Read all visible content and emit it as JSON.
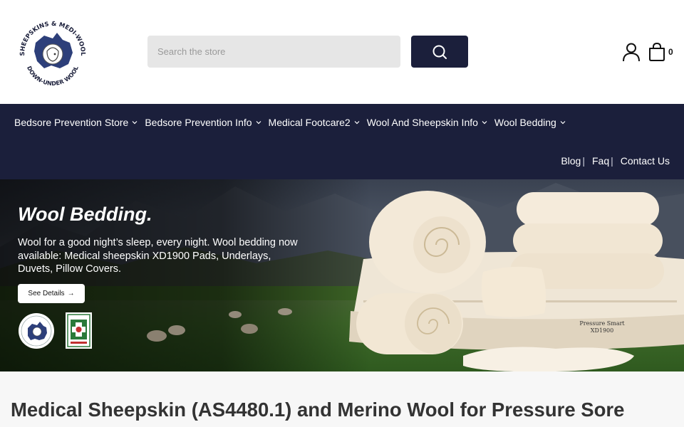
{
  "header": {
    "logo_text_top": "SHEEPSKINS & MEDI-WOOL",
    "logo_text_bottom": "DOWN-UNDER WOOL",
    "search_placeholder": "Search the store",
    "cart_count": "0"
  },
  "nav": {
    "items": [
      {
        "label": "Bedsore Prevention Store"
      },
      {
        "label": "Bedsore Prevention Info"
      },
      {
        "label": "Medical Footcare2"
      },
      {
        "label": "Wool And Sheepskin Info"
      },
      {
        "label": "Wool Bedding"
      }
    ],
    "links": [
      {
        "label": "Blog",
        "sep": "|"
      },
      {
        "label": "Faq",
        "sep": "|"
      },
      {
        "label": "Contact Us"
      }
    ]
  },
  "hero": {
    "title": "Wool Bedding.",
    "text": "Wool for a good night’s sleep, every night. Wool bedding now available: Medical sheepskin XD1900 Pads, Underlays, Duvets, Pillow Covers.",
    "button_label": "See Details",
    "mattress_label_1": "Pressure Smart",
    "mattress_label_2": "XD1900"
  },
  "main": {
    "title": "Medical Sheepskin (AS4480.1) and Merino Wool for Pressure Sore"
  },
  "colors": {
    "navy": "#1b1f3b",
    "search_bg": "#e6e6e6",
    "cream": "#efe3cf"
  }
}
